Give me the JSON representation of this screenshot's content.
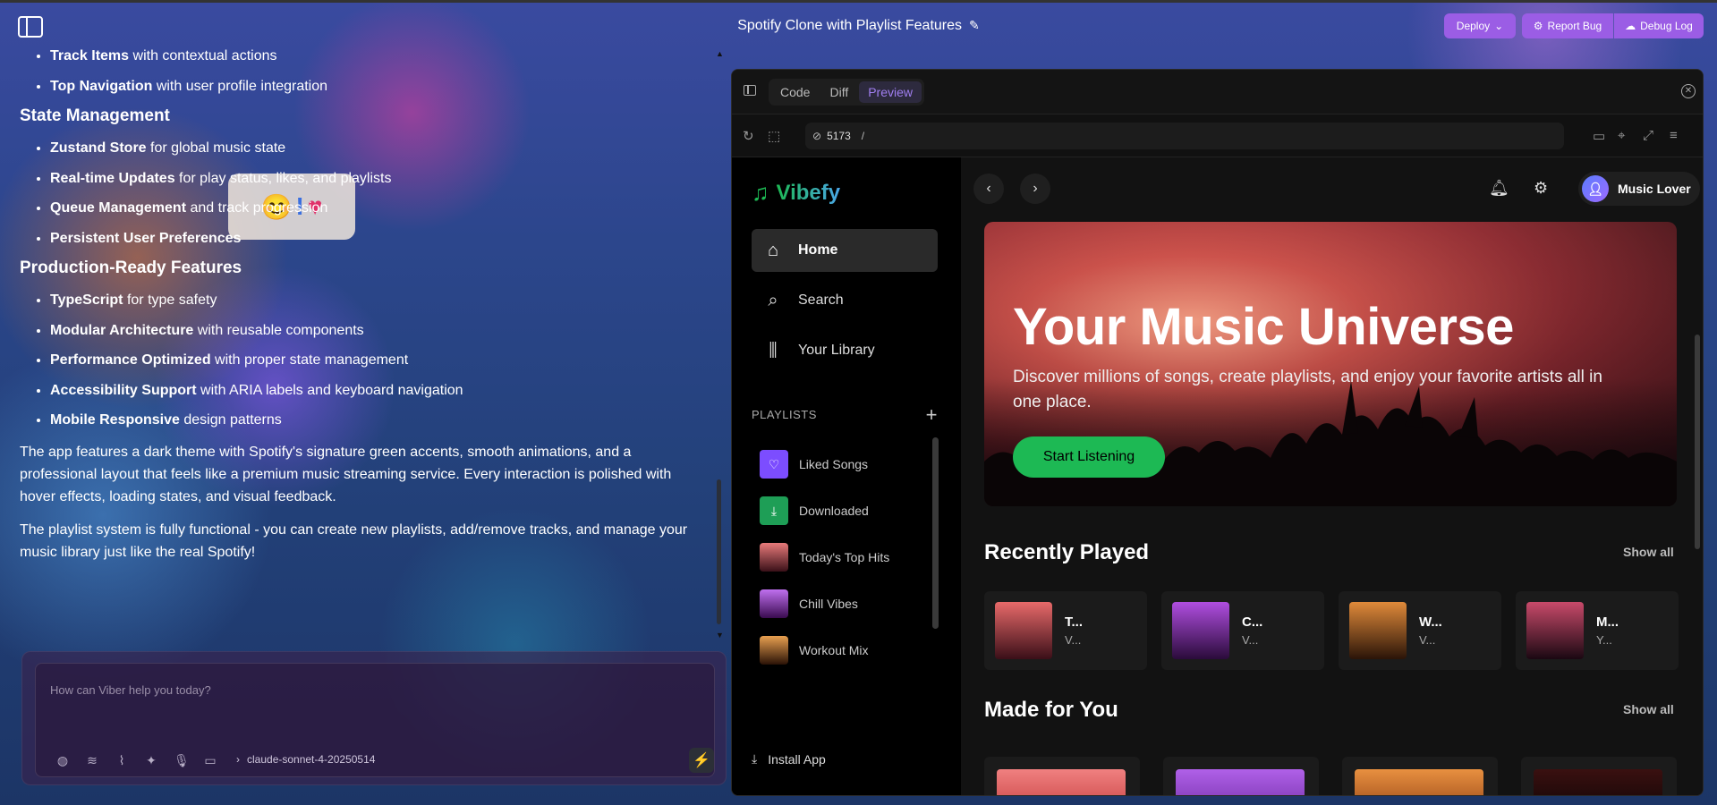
{
  "topbar": {
    "title": "Spotify Clone with Playlist Features",
    "deploy_label": "Deploy",
    "report_label": "Report Bug",
    "debug_label": "Debug Log",
    "accent": "#9b5de5"
  },
  "chat": {
    "list1": [
      {
        "bold": "Track Items",
        "rest": " with contextual actions"
      },
      {
        "bold": "Top Navigation",
        "rest": " with user profile integration"
      }
    ],
    "h_state": "State Management",
    "list2": [
      {
        "bold": "Zustand Store",
        "rest": " for global music state"
      },
      {
        "bold": "Real-time Updates",
        "rest": " for play status, likes, and playlists"
      },
      {
        "bold": "Queue Management",
        "rest": " and track progression"
      },
      {
        "bold": "Persistent User Preferences",
        "rest": ""
      }
    ],
    "h_prod": "Production-Ready Features",
    "list3": [
      {
        "bold": "TypeScript",
        "rest": " for type safety"
      },
      {
        "bold": "Modular Architecture",
        "rest": " with reusable components"
      },
      {
        "bold": "Performance Optimized",
        "rest": " with proper state management"
      },
      {
        "bold": "Accessibility Support",
        "rest": " with ARIA labels and keyboard navigation"
      },
      {
        "bold": "Mobile Responsive",
        "rest": " design patterns"
      }
    ],
    "p1": "The app features a dark theme with Spotify's signature green accents, smooth animations, and a professional layout that feels like a premium music streaming service. Every interaction is polished with hover effects, loading states, and visual feedback.",
    "p2": "The playlist system is fully functional - you can create new playlists, add/remove tracks, and manage your music library just like the real Spotify!"
  },
  "input": {
    "placeholder": "How can Viber help you today?",
    "model": "claude-sonnet-4-20250514",
    "tool_icons": [
      "palette-icon",
      "stack-icon",
      "paperclip-icon",
      "sparkle-icon",
      "microphone-icon",
      "chat-icon"
    ]
  },
  "preview": {
    "tabs": [
      "Code",
      "Diff",
      "Preview"
    ],
    "active_tab": "Preview",
    "port": "5173",
    "path": "/"
  },
  "app": {
    "brand": "Vibefy",
    "brand_color": "#1db954",
    "nav": [
      {
        "label": "Home",
        "icon": "home-icon",
        "active": true
      },
      {
        "label": "Search",
        "icon": "search-icon",
        "active": false
      },
      {
        "label": "Your Library",
        "icon": "library-icon",
        "active": false
      }
    ],
    "playlists_header": "PLAYLISTS",
    "playlists": [
      {
        "label": "Liked Songs",
        "icon": "heart-icon",
        "color": "#7c4dff"
      },
      {
        "label": "Downloaded",
        "icon": "download-icon",
        "color": "#1e9e56"
      },
      {
        "label": "Today's Top Hits",
        "icon": "cover-image",
        "color": "#b84848"
      },
      {
        "label": "Chill Vibes",
        "icon": "cover-image",
        "color": "#8a3bd1"
      },
      {
        "label": "Workout Mix",
        "icon": "cover-image",
        "color": "#c46a2a"
      }
    ],
    "install": "Install App",
    "user": "Music Lover",
    "hero": {
      "title": "Your Music Universe",
      "subtitle": "Discover millions of songs, create playlists, and enjoy your favorite artists all in one place.",
      "button": "Start Listening"
    },
    "recent_title": "Recently Played",
    "made_title": "Made for You",
    "show_all": "Show all",
    "recent": [
      {
        "t": "T...",
        "s": "V...",
        "c1": "#e86a6a",
        "c2": "#3a0f18"
      },
      {
        "t": "C...",
        "s": "V...",
        "c1": "#b04ee0",
        "c2": "#2a0b3a"
      },
      {
        "t": "W...",
        "s": "V...",
        "c1": "#e08a3a",
        "c2": "#2a1408"
      },
      {
        "t": "M...",
        "s": "Y...",
        "c1": "#c84a6a",
        "c2": "#1a0812"
      }
    ],
    "made": [
      {
        "c1": "#f08080",
        "c2": "#c03838"
      },
      {
        "c1": "#b060e8",
        "c2": "#6a2aa0"
      },
      {
        "c1": "#e89040",
        "c2": "#8a3a10"
      },
      {
        "c1": "#3a1010",
        "c2": "#0a0404"
      }
    ]
  }
}
